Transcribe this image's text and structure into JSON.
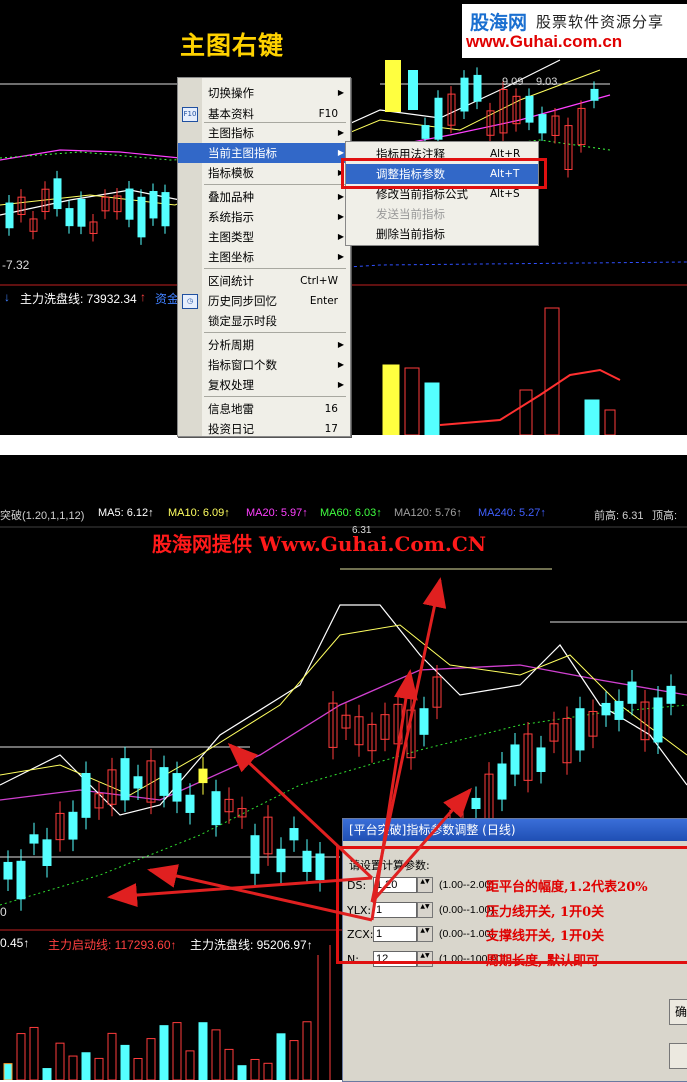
{
  "top_panel": {
    "heading": "主图右键",
    "logo_cn": "股海网",
    "logo_sub": "股票软件资源分享",
    "logo_url": "www.Guhai.com.cn",
    "price_labels": [
      "9.09",
      "9.03"
    ],
    "axis_label": "-7.32",
    "status_a": "主力洗盘线: 73932.34",
    "status_b": "资金",
    "colors": {
      "bg": "#000000",
      "up": "#ff3c3c",
      "down": "#55ffff",
      "highlight": "#3268c8"
    }
  },
  "context_menu": {
    "items": [
      {
        "label": "切换操作",
        "arrow": "▶"
      },
      {
        "label": "基本资料",
        "shortcut": "F10",
        "icon": "f10-icon"
      },
      {
        "label": "主图指标",
        "arrow": "▶"
      },
      {
        "label": "当前主图指标",
        "arrow": "▶",
        "highlighted": true
      },
      {
        "label": "指标模板",
        "arrow": "▶"
      },
      {
        "label": "叠加品种",
        "arrow": "▶"
      },
      {
        "label": "系统指示",
        "arrow": "▶"
      },
      {
        "label": "主图类型",
        "arrow": "▶"
      },
      {
        "label": "主图坐标",
        "arrow": "▶"
      },
      {
        "label": "区间统计",
        "shortcut": "Ctrl+W"
      },
      {
        "label": "历史同步回忆",
        "shortcut": "Enter",
        "icon": "sync-icon"
      },
      {
        "label": "锁定显示时段"
      },
      {
        "label": "分析周期",
        "arrow": "▶"
      },
      {
        "label": "指标窗口个数",
        "arrow": "▶"
      },
      {
        "label": "复权处理",
        "arrow": "▶"
      },
      {
        "label": "信息地雷",
        "shortcut": "16"
      },
      {
        "label": "投资日记",
        "shortcut": "17"
      }
    ],
    "submenu": [
      {
        "label": "指标用法注释",
        "shortcut": "Alt+R"
      },
      {
        "label": "调整指标参数",
        "shortcut": "Alt+T",
        "highlighted": true
      },
      {
        "label": "修改当前指标公式",
        "shortcut": "Alt+S"
      },
      {
        "label": "发送当前指标",
        "disabled": true
      },
      {
        "label": "删除当前指标"
      }
    ]
  },
  "bottom_panel": {
    "ma_line": [
      {
        "text": "突破(1.20,1,1,12)",
        "color": "#d0d0d0"
      },
      {
        "text": "MA5: 6.12↑",
        "color": "#ffffff"
      },
      {
        "text": "MA10: 6.09↑",
        "color": "#ffff60"
      },
      {
        "text": "MA20: 5.97↑",
        "color": "#ff40ff"
      },
      {
        "text": "MA60: 6.03↑",
        "color": "#40ff40"
      },
      {
        "text": "MA120: 5.76↑",
        "color": "#a0a0a0"
      },
      {
        "text": "MA240: 5.27↑",
        "color": "#4060ff"
      },
      {
        "text": "前高: 6.31",
        "color": "#d0d0d0"
      },
      {
        "text": "顶高:",
        "color": "#d0d0d0"
      }
    ],
    "watermark": "股海网提供 Www.Guhai.Com.CN",
    "high_label": "6.31",
    "status_a": "0.45↑",
    "status_b": "主力启动线: 117293.60↑",
    "status_c": "主力洗盘线: 95206.97↑",
    "axis_label": "0"
  },
  "dialog": {
    "title": "[平台突破]指标参数调整 (日线)",
    "prompt": "请设置计算参数:",
    "params": [
      {
        "name": "DS:",
        "value": "1.20",
        "range": "(1.00--2.00)",
        "note": "距平台的幅度,1.2代表20%"
      },
      {
        "name": "YLX:",
        "value": "1",
        "range": "(0.00--1.00)",
        "note": "压力线开关, 1开0关"
      },
      {
        "name": "ZCX:",
        "value": "1",
        "range": "(0.00--1.00)",
        "note": "支撑线开关, 1开0关"
      },
      {
        "name": "N:",
        "value": "12",
        "range": "(1.00--100.00)",
        "note": "周期长度, 默认即可"
      }
    ],
    "button_partial": "确"
  }
}
